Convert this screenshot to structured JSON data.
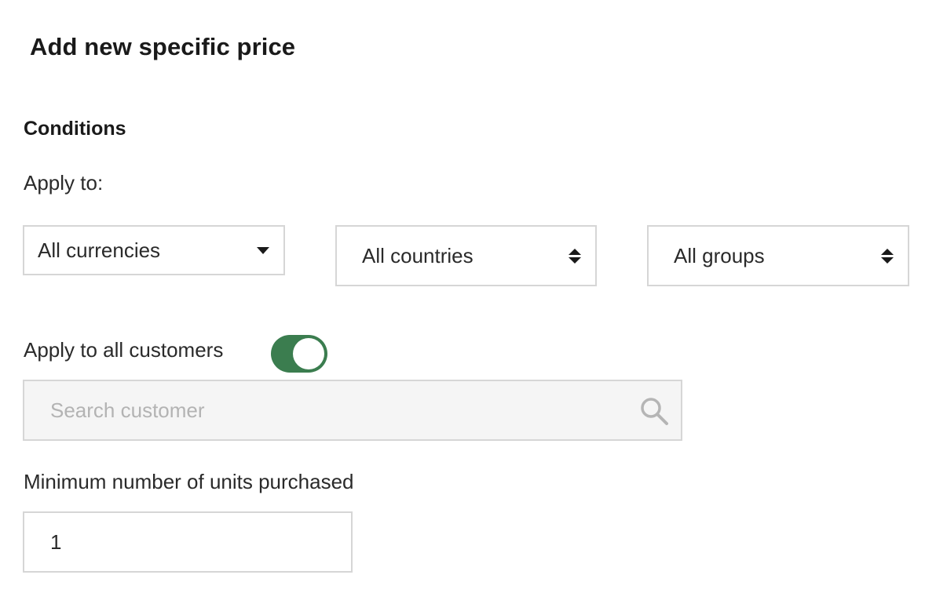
{
  "modal": {
    "title": "Add new specific price"
  },
  "conditions": {
    "section_title": "Conditions",
    "apply_to_label": "Apply to:",
    "currency_select": {
      "selected": "All currencies"
    },
    "country_select": {
      "selected": "All countries"
    },
    "group_select": {
      "selected": "All groups"
    },
    "customers": {
      "label": "Apply to all customers",
      "toggle_on": true,
      "toggle_color": "#3b7d4f"
    },
    "search": {
      "placeholder": "Search customer",
      "value": "",
      "icon": "search-icon"
    },
    "min_units": {
      "label": "Minimum number of units purchased",
      "value": "1"
    }
  }
}
